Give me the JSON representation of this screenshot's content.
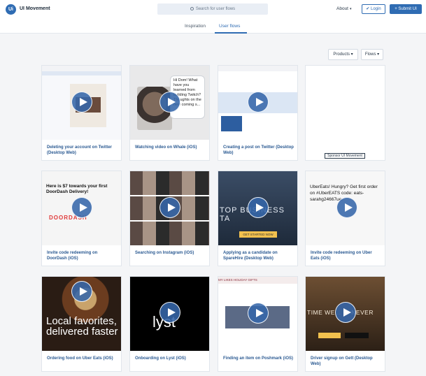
{
  "header": {
    "logo_text": "Ui",
    "brand": "UI Movement",
    "search_placeholder": "Search for user flows",
    "about": "About",
    "login": "Login",
    "submit": "Submit UI"
  },
  "subnav": {
    "tabs": [
      {
        "label": "Inspiration"
      },
      {
        "label": "User flows"
      }
    ]
  },
  "filters": {
    "products": "Products",
    "flows": "Flows"
  },
  "cards": [
    {
      "caption": "Deleting your account on Twitter (Desktop Web)"
    },
    {
      "caption": "Watching video on Whale (iOS)",
      "thumb_text": "Hi Dom! What have you learned from building Twitch? Thoughts on the new coming s..."
    },
    {
      "caption": "Creating a post on Twitter (Desktop Web)"
    },
    {
      "sponsor_label": "Sponsor UI Movement"
    },
    {
      "caption": "Invite code redeeming on DoorDash (iOS)",
      "thumb_text": "Here is $7 towards your first DoorDash Delivery!",
      "logo_text": "DOORDASH"
    },
    {
      "caption": "Searching on Instagram (iOS)"
    },
    {
      "caption": "Applying as a candidate on SpareHire (Desktop Web)",
      "thumb_text": "TOP BUSINESS TA",
      "btn_text": "GET STARTED NOW"
    },
    {
      "caption": "Invite code redeeming on Uber Eats (iOS)",
      "thumb_text": "UberEats! Hungry? Get first order on #UberEATS code: eats-sarahg24667ue."
    },
    {
      "caption": "Ordering food on Uber Eats (iOS)",
      "thumb_text": "Local favorites, delivered faster"
    },
    {
      "caption": "Onboarding on Lyst (iOS)",
      "thumb_text": "lyst"
    },
    {
      "caption": "Finding an item on Poshmark (iOS)",
      "thumb_text": "MY LIKES  HOLIDAY GIFTS"
    },
    {
      "caption": "Driver signup on Gett (Desktop Web)",
      "thumb_text": "TIME WE... IS NEVER"
    }
  ]
}
